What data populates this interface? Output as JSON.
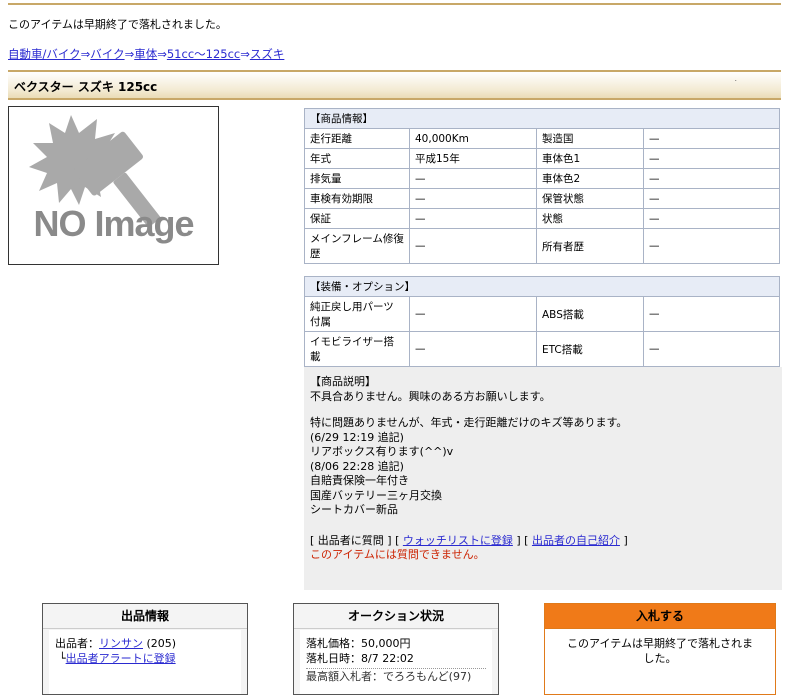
{
  "notice": "このアイテムは早期終了で落札されました。",
  "breadcrumb": {
    "items": [
      "自動車/バイク",
      "バイク",
      "車体",
      "51cc〜125cc",
      "スズキ"
    ],
    "separator": "⇒"
  },
  "title": "ベクスター スズキ 125cc",
  "image": {
    "text": "NO Image"
  },
  "product_info": {
    "header": "【商品情報】",
    "rows": [
      [
        "走行距離",
        "40,000Km",
        "製造国",
        "—"
      ],
      [
        "年式",
        "平成15年",
        "車体色1",
        "—"
      ],
      [
        "排気量",
        "—",
        "車体色2",
        "—"
      ],
      [
        "車検有効期限",
        "—",
        "保管状態",
        "—"
      ],
      [
        "保証",
        "—",
        "状態",
        "—"
      ],
      [
        "メインフレーム修復歴",
        "—",
        "所有者歴",
        "—"
      ]
    ]
  },
  "options": {
    "header": "【装備・オプション】",
    "rows": [
      [
        "純正戻し用パーツ付属",
        "—",
        "ABS搭載",
        "—"
      ],
      [
        "イモビライザー搭載",
        "—",
        "ETC搭載",
        "—"
      ]
    ]
  },
  "description": {
    "header": "【商品説明】",
    "lines1": [
      "不具合ありません。興味のある方お願いします。"
    ],
    "lines2": [
      "特に問題ありませんが、年式・走行距離だけのキズ等あります。",
      "(6/29 12:19 追記)",
      "リアボックス有ります(^^)v",
      "(8/06 22:28 追記)",
      "自賠責保険一年付き",
      "国産バッテリー三ヶ月交換",
      "シートカバー新品"
    ],
    "links": {
      "open": "[ 出品者に質問 ] [ ",
      "watch": "ウォッチリストに登録",
      "mid": " ] [ ",
      "intro": "出品者の自己紹介",
      "close": " ]"
    },
    "warning": "このアイテムには質問できません。"
  },
  "seller_box": {
    "title": "出品情報",
    "seller_label": "出品者：",
    "seller_name": "リンサン",
    "seller_rating": "(205)",
    "alert_prefix": "└",
    "alert_link": "出品者アラートに登録"
  },
  "auction_box": {
    "title": "オークション状況",
    "price_label": "落札価格：",
    "price": "50,000円",
    "date_label": "落札日時：",
    "date": "8/7 22:02",
    "bidder_partial": "最高額入札者：でろろもんど(97)"
  },
  "bid_box": {
    "title": "入札する",
    "message": "このアイテムは早期終了で落札されました。"
  },
  "colors": {
    "gold_rule": "#c8a868",
    "table_header": "#e7ecf6",
    "bid_orange": "#f07a18",
    "link": "#2a2ad0",
    "warning": "#cc2200"
  }
}
